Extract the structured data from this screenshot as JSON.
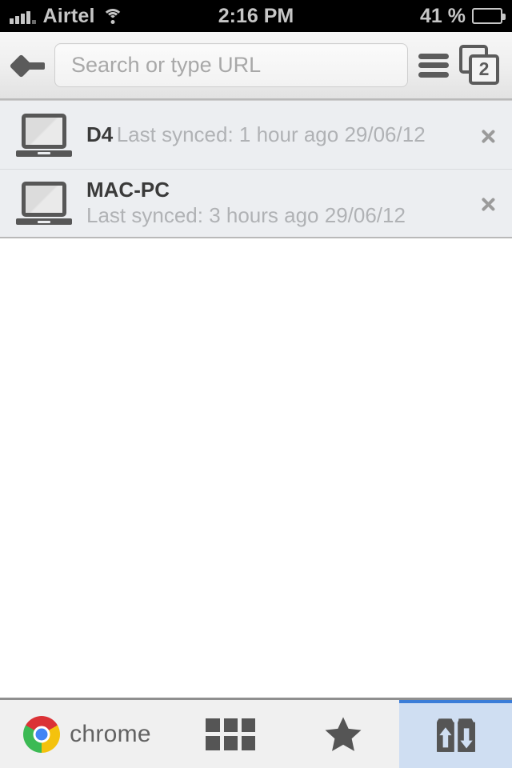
{
  "status_bar": {
    "signal_icon": "signal-bars-icon",
    "carrier": "Airtel",
    "wifi_icon": "wifi-icon",
    "time": "2:16 PM",
    "battery_percent": "41 %",
    "battery_level": 41,
    "battery_icon": "battery-icon"
  },
  "toolbar": {
    "back_icon": "back-arrow-icon",
    "omnibox_placeholder": "Search or type URL",
    "omnibox_value": "",
    "menu_icon": "hamburger-menu-icon",
    "tab_count": "2",
    "tabs_icon": "tab-switcher-icon"
  },
  "devices": [
    {
      "name": "D4",
      "last_synced": "Last synced: 1 hour ago 29/06/12",
      "icon": "laptop-icon",
      "chevron": "chevron-right-icon"
    },
    {
      "name": "MAC-PC",
      "last_synced": "Last synced: 3 hours ago 29/06/12",
      "icon": "laptop-icon",
      "chevron": "chevron-right-icon"
    }
  ],
  "bottom_bar": {
    "items": [
      {
        "label": "chrome",
        "icon": "chrome-logo-icon",
        "selected": false
      },
      {
        "label": "",
        "icon": "most-visited-grid-icon",
        "selected": false
      },
      {
        "label": "",
        "icon": "bookmarks-star-icon",
        "selected": false
      },
      {
        "label": "",
        "icon": "other-devices-sync-icon",
        "selected": true
      }
    ],
    "selected_accent": "#3b7dd8",
    "selected_background": "#cfdef2"
  }
}
